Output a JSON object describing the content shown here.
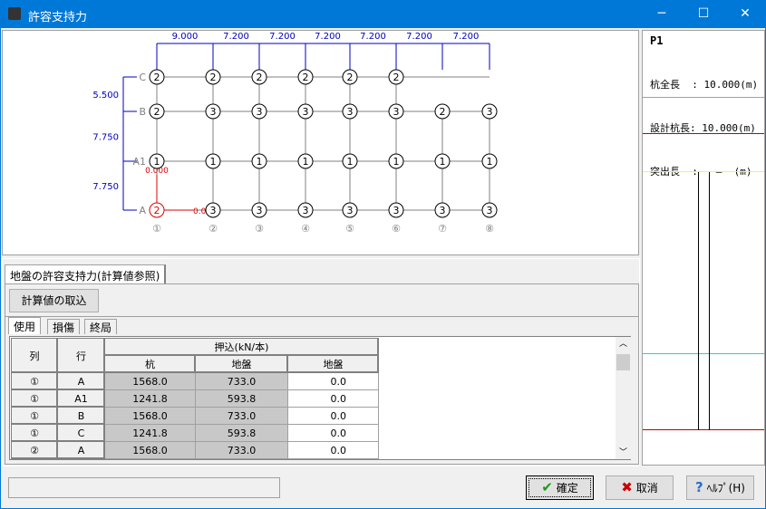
{
  "window": {
    "title": "許容支持力",
    "minimize": "─",
    "maximize": "☐",
    "close": "✕"
  },
  "diagram": {
    "x_spans": [
      "9.000",
      "7.200",
      "7.200",
      "7.200",
      "7.200",
      "7.200",
      "7.200"
    ],
    "y_spans": [
      "5.500",
      "7.750",
      "7.750"
    ],
    "row_labels": [
      "C",
      "B",
      "A1",
      "A"
    ],
    "column_labels": [
      "①",
      "②",
      "③",
      "④",
      "⑤",
      "⑥",
      "⑦",
      "⑧"
    ],
    "pile_types": [
      [
        "2",
        "2",
        "2",
        "2",
        "2",
        "2",
        null,
        null
      ],
      [
        "2",
        "3",
        "3",
        "3",
        "3",
        "3",
        "2",
        "3"
      ],
      [
        "1",
        "1",
        "1",
        "1",
        "1",
        "1",
        "1",
        "1"
      ],
      [
        "2",
        "3",
        "3",
        "3",
        "3",
        "3",
        "3",
        "3"
      ]
    ],
    "selected": {
      "row": 3,
      "col": 0
    },
    "offset_x": "0.000",
    "offset_y": "0.000",
    "colors": {
      "dimension": "#0000c0",
      "grid": "#808080",
      "selected": "#e00000"
    }
  },
  "side": {
    "pile": "P1",
    "lines": [
      {
        "label": "杭全長  ",
        "value": ": 10.000(m)"
      },
      {
        "label": "設計杭長",
        "value": ": 10.000(m)"
      },
      {
        "label": "突出長  ",
        "value": ":   ―  (m)"
      }
    ],
    "level_colors": [
      "#c00000",
      "#ffff00",
      "#00e0e0",
      "#c00000"
    ]
  },
  "main_tab": "地盤の許容支持力(計算値参照)",
  "import_button": "計算値の取込",
  "sub_tabs": [
    "使用",
    "損傷",
    "終局"
  ],
  "table": {
    "headers": {
      "col": "列",
      "row": "行",
      "group": "押込(kN/本)",
      "sub": [
        "杭",
        "地盤",
        "地盤"
      ]
    },
    "rows": [
      [
        "①",
        "A",
        "1568.0",
        "733.0",
        "0.0"
      ],
      [
        "①",
        "A1",
        "1241.8",
        "593.8",
        "0.0"
      ],
      [
        "①",
        "B",
        "1568.0",
        "733.0",
        "0.0"
      ],
      [
        "①",
        "C",
        "1241.8",
        "593.8",
        "0.0"
      ],
      [
        "②",
        "A",
        "1568.0",
        "733.0",
        "0.0"
      ]
    ]
  },
  "status_text": "",
  "buttons": {
    "ok": "確定",
    "cancel": "取消",
    "help": "ﾍﾙﾌﾟ(H)"
  }
}
